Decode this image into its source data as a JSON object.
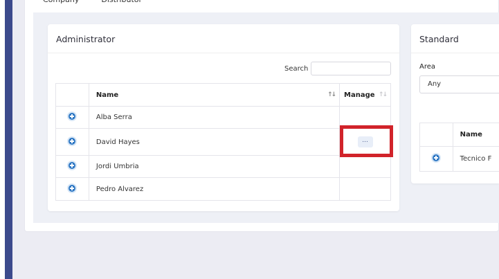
{
  "tabs": [
    "Company",
    "Distributor"
  ],
  "admin": {
    "title": "Administrator",
    "search_label": "Search",
    "columns": {
      "name": "Name",
      "manage": "Manage"
    },
    "rows": [
      {
        "name": "Alba Serra",
        "manage": ""
      },
      {
        "name": "David Hayes",
        "manage": "..."
      },
      {
        "name": "Jordi Umbria",
        "manage": ""
      },
      {
        "name": "Pedro Alvarez",
        "manage": ""
      }
    ]
  },
  "standard": {
    "title": "Standard",
    "area_label": "Area",
    "area_value": "Any",
    "columns": {
      "name": "Name"
    },
    "rows": [
      {
        "name": "Tecnico F"
      }
    ]
  },
  "colors": {
    "sidebar_accent": "#3c4a8c",
    "expand_icon": "#2f78c4",
    "highlight": "#d1232a"
  }
}
